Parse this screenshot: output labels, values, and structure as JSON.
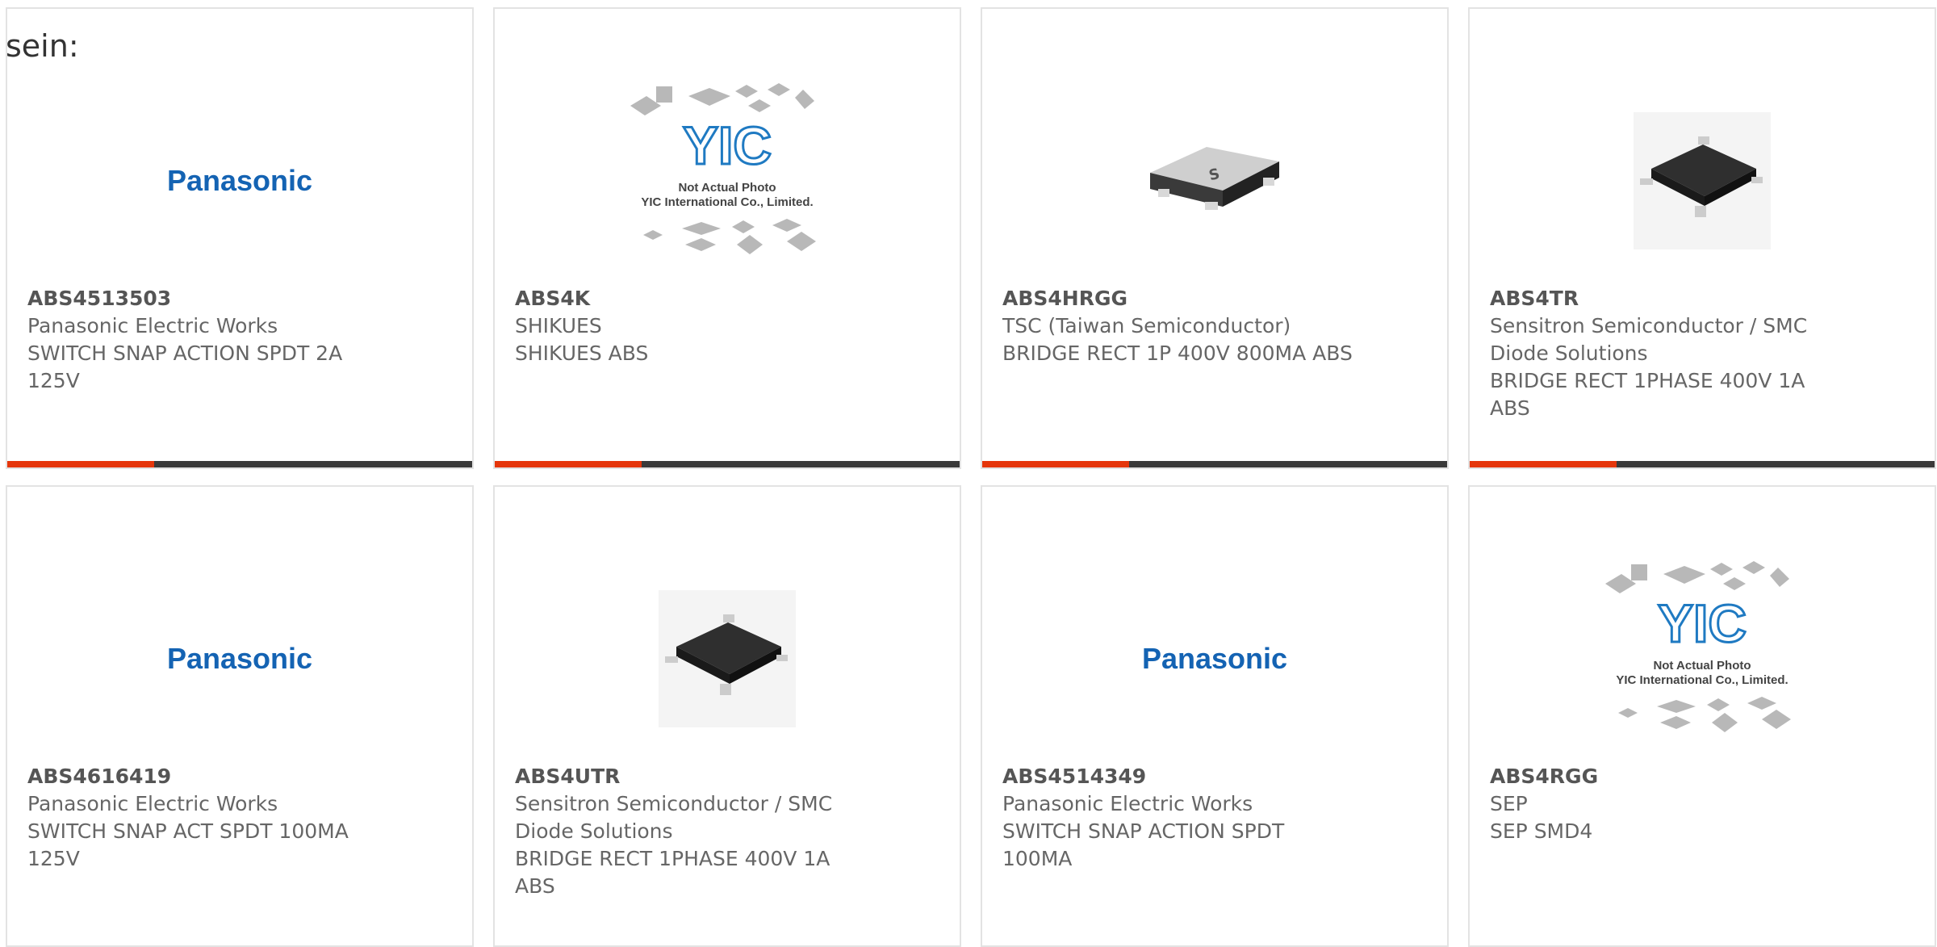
{
  "intro_label": "sein:",
  "colors": {
    "accent_bar": "#e5360b",
    "bar": "#3a3a3a",
    "brand_logo": "#1463b3",
    "card_border": "#e3e3e3"
  },
  "cards": [
    {
      "part": "ABS4513503",
      "manufacturer": "Panasonic Electric Works",
      "description": "SWITCH SNAP ACTION SPDT 2A 125V",
      "image": "panasonic-logo",
      "logo_text": "Panasonic"
    },
    {
      "part": "ABS4K",
      "manufacturer": "SHIKUES",
      "description": "SHIKUES ABS",
      "image": "yic-placeholder",
      "logo_text": "YIC",
      "caption_1": "Not Actual Photo",
      "caption_2": "YIC International Co., Limited."
    },
    {
      "part": "ABS4HRGG",
      "manufacturer": "TSC (Taiwan Semiconductor)",
      "description": "BRIDGE RECT 1P 400V 800MA ABS",
      "image": "tsc-chip-photo",
      "logo_text": "S"
    },
    {
      "part": "ABS4TR",
      "manufacturer": "Sensitron Semiconductor / SMC Diode Solutions",
      "description": "BRIDGE RECT 1PHASE 400V 1A ABS",
      "image": "smd-chip-photo"
    },
    {
      "part": "ABS4616419",
      "manufacturer": "Panasonic Electric Works",
      "description": "SWITCH SNAP ACT SPDT 100MA 125V",
      "image": "panasonic-logo",
      "logo_text": "Panasonic"
    },
    {
      "part": "ABS4UTR",
      "manufacturer": "Sensitron Semiconductor / SMC Diode Solutions",
      "description": "BRIDGE RECT 1PHASE 400V 1A ABS",
      "image": "smd-chip-photo"
    },
    {
      "part": "ABS4514349",
      "manufacturer": "Panasonic Electric Works",
      "description": "SWITCH SNAP ACTION SPDT 100MA",
      "image": "panasonic-logo",
      "logo_text": "Panasonic"
    },
    {
      "part": "ABS4RGG",
      "manufacturer": "SEP",
      "description": "SEP SMD4",
      "image": "yic-placeholder",
      "logo_text": "YIC",
      "caption_1": "Not Actual Photo",
      "caption_2": "YIC International Co., Limited."
    }
  ]
}
